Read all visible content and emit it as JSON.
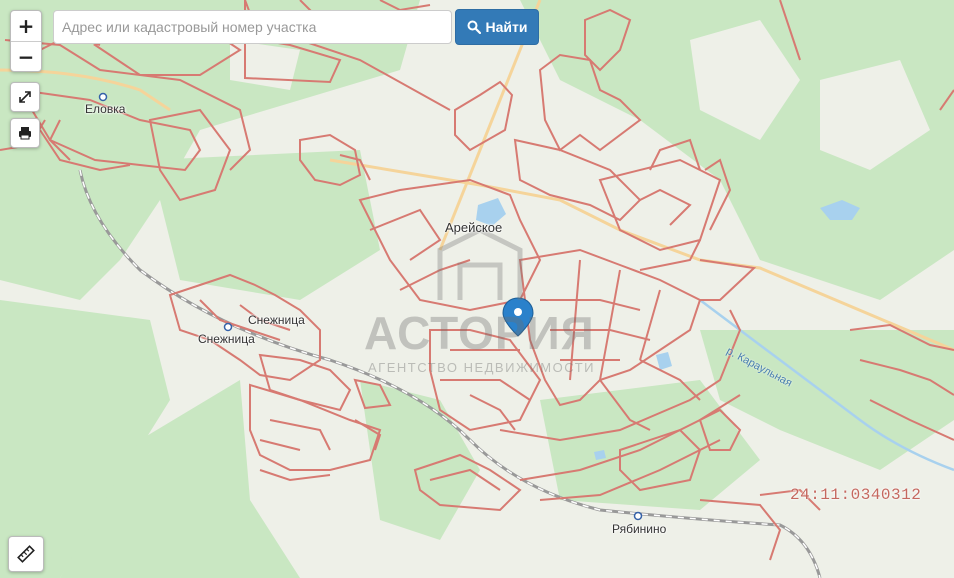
{
  "search": {
    "placeholder": "Адрес или кадастровый номер участка",
    "button_label": "Найти"
  },
  "controls": {
    "zoom_in": "+",
    "zoom_out": "−"
  },
  "places": {
    "elovka": "Еловка",
    "areyskoe": "Арейское",
    "snezhnitsa_station": "Снежница",
    "snezhnitsa": "Снежница",
    "ryabinino": "Рябинино",
    "river": "р. Караульная"
  },
  "cadastral_number": "24:11:0340312",
  "watermark": {
    "brand": "АСТОРИЯ",
    "tagline": "АГЕНТСТВО НЕДВИЖИМОСТИ"
  },
  "colors": {
    "forest": "#c8e6c1",
    "meadow": "#eef0e8",
    "parcel_border": "#d77a72",
    "road": "#e0a060",
    "water": "#a8d1ee",
    "button": "#337ab7",
    "marker": "#2a81cb"
  }
}
